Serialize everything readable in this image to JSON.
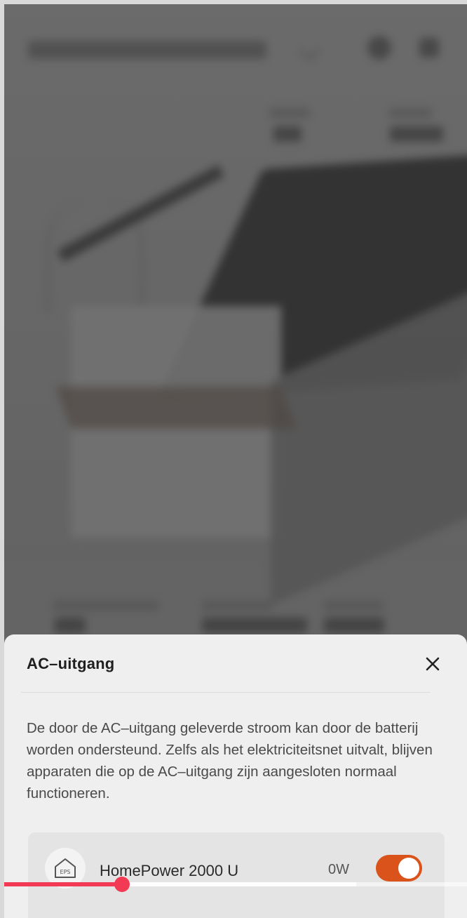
{
  "sheet": {
    "title": "AC–uitgang",
    "description": "De door de AC–uitgang geleverde stroom kan door de batterij worden ondersteund. Zelfs als het elektriciteitsnet uitvalt, blijven apparaten die op de AC–uitgang zijn aangesloten normaal functioneren.",
    "close_icon": "close-icon"
  },
  "device": {
    "icon": "eps-house-icon",
    "icon_label": "EPS",
    "name": "HomePower 2000 U",
    "power": "0W",
    "toggle_on": true,
    "toggle_color": "#d9531a"
  },
  "video": {
    "progress_fraction": 0.255,
    "buffered_fraction": 0.76,
    "accent_color": "#f23a54"
  }
}
